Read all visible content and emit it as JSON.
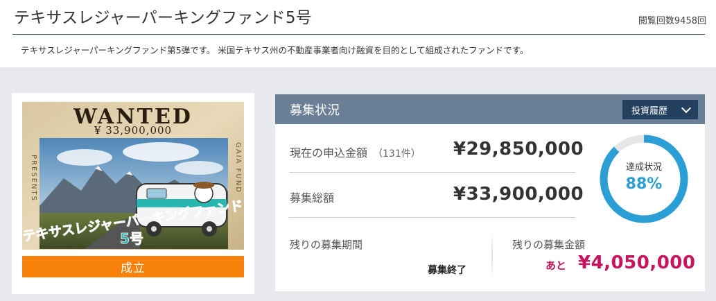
{
  "header": {
    "title": "テキサスレジャーパーキングファンド5号",
    "view_count": "閲覧回数9458回",
    "description": "テキサスレジャーパーキングファンド第5弾です。 米国テキサス州の不動産事業者向け融資を目的として組成されたファンドです。"
  },
  "image": {
    "wanted_text": "WANTED",
    "amount_text": "¥ 33,900,000",
    "side_left_text": "PRESENTS",
    "side_right_text": "GAIA FUND",
    "banner_text": "テキサスレジャーパーキングファンド",
    "number_text": "5号",
    "status": "成立"
  },
  "panel": {
    "title": "募集状況",
    "history_button": "投資履歴",
    "applied_label": "現在の申込金額",
    "applied_count": "（131件）",
    "applied_amount": "¥29,850,000",
    "total_label": "募集総額",
    "total_amount": "¥33,900,000",
    "progress_label": "達成状況",
    "progress_value": "88%",
    "progress_fraction": 0.88,
    "period_label": "残りの募集期間",
    "period_value": "募集終了",
    "remain_label": "残りの募集金額",
    "remain_prefix": "あと",
    "remain_amount": "¥4,050,000"
  },
  "colors": {
    "accent_orange": "#f7810a",
    "panel_header": "#6a7f95",
    "button_navy": "#23415e",
    "ring_blue": "#2b9fd5",
    "remain_magenta": "#c8145c"
  }
}
